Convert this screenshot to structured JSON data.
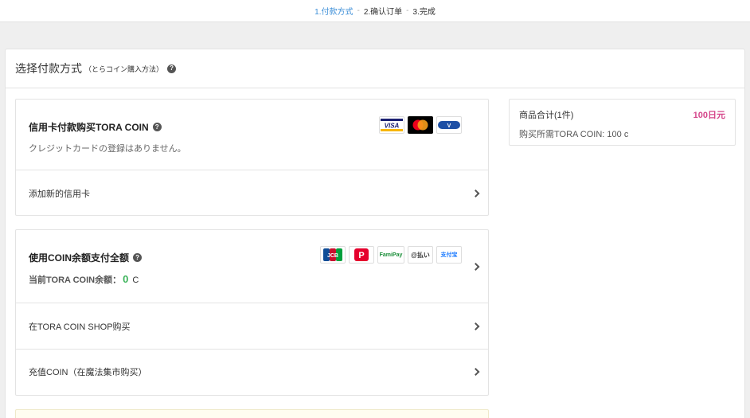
{
  "steps": [
    "1.付款方式",
    "2.确认订单",
    "3.完成"
  ],
  "step_separator": "-",
  "header": {
    "title": "选择付款方式",
    "subtitle": "（とらコイン購入方法）",
    "help": "?"
  },
  "card_credit": {
    "title": "信用卡付款购买TORA COIN",
    "note": "クレジットカードの登録はありません。",
    "add_card_label": "添加新的信用卡",
    "logos": [
      "VISA",
      "MC",
      "V"
    ]
  },
  "card_coin": {
    "title": "使用COIN余额支付全额",
    "balance_label": "当前TORA COIN余额：",
    "balance_value": "0",
    "balance_unit": "C",
    "logos": [
      "JCB",
      "P",
      "FamiPay",
      "@払い",
      "支付宝"
    ],
    "shop_label": "在TORA COIN SHOP购买",
    "recharge_label": "充值COIN（在魔法集市购买）"
  },
  "summary": {
    "label": "商品合计(1件)",
    "price": "100日元",
    "need": "购买所需TORA COIN: 100 c"
  },
  "colors": {
    "accent": "#3d8fd8",
    "price": "#d5468b",
    "balance": "#3cb35a"
  }
}
